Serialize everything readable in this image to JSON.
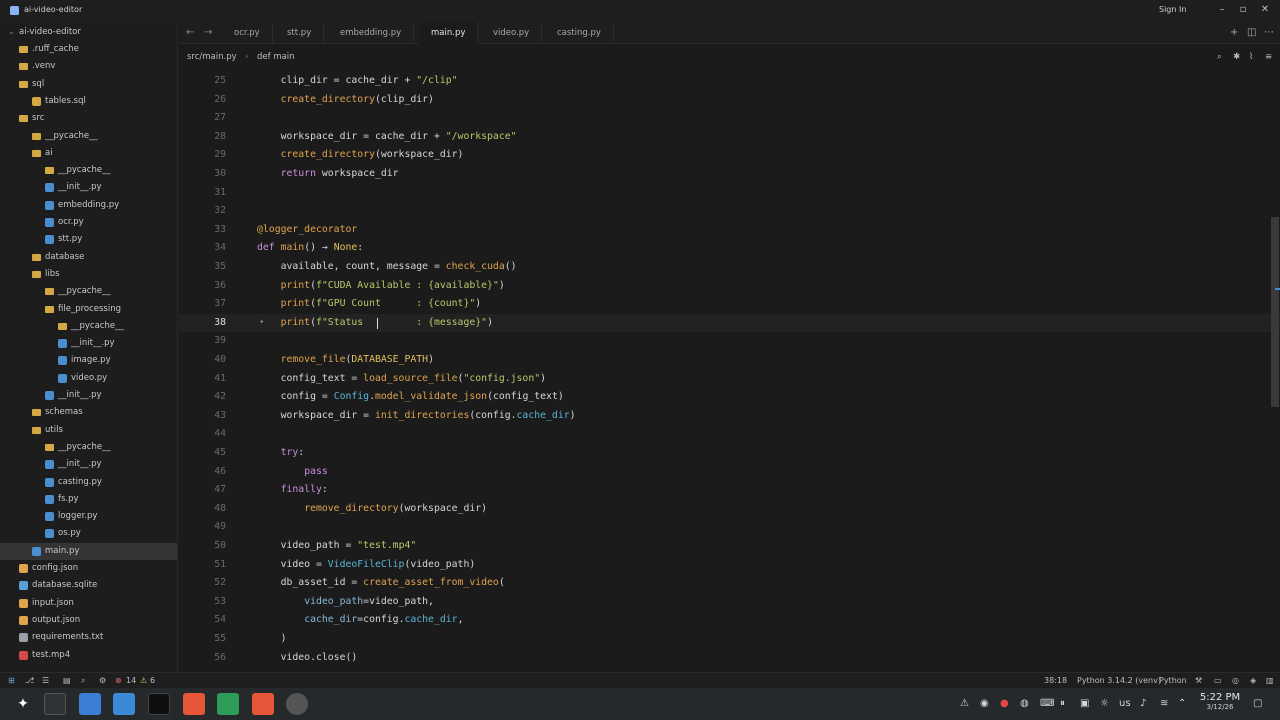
{
  "window": {
    "title": "ai-video-editor",
    "sign_in": "Sign In"
  },
  "sidebar": {
    "root": "ai-video-editor",
    "items": [
      {
        "label": ".ruff_cache",
        "kind": "folder",
        "depth": 1
      },
      {
        "label": ".venv",
        "kind": "folder",
        "depth": 1
      },
      {
        "label": "sql",
        "kind": "folder",
        "depth": 1
      },
      {
        "label": "tables.sql",
        "kind": "sql",
        "depth": 2
      },
      {
        "label": "src",
        "kind": "folder",
        "depth": 1
      },
      {
        "label": "__pycache__",
        "kind": "folder",
        "depth": 2
      },
      {
        "label": "ai",
        "kind": "folder",
        "depth": 2
      },
      {
        "label": "__pycache__",
        "kind": "folder",
        "depth": 3
      },
      {
        "label": "__init__.py",
        "kind": "py",
        "depth": 3
      },
      {
        "label": "embedding.py",
        "kind": "py",
        "depth": 3
      },
      {
        "label": "ocr.py",
        "kind": "py",
        "depth": 3
      },
      {
        "label": "stt.py",
        "kind": "py",
        "depth": 3
      },
      {
        "label": "database",
        "kind": "folder",
        "depth": 2
      },
      {
        "label": "libs",
        "kind": "folder",
        "depth": 2
      },
      {
        "label": "__pycache__",
        "kind": "folder",
        "depth": 3
      },
      {
        "label": "file_processing",
        "kind": "folder",
        "depth": 3
      },
      {
        "label": "__pycache__",
        "kind": "folder",
        "depth": 4
      },
      {
        "label": "__init__.py",
        "kind": "py",
        "depth": 4
      },
      {
        "label": "image.py",
        "kind": "py",
        "depth": 4
      },
      {
        "label": "video.py",
        "kind": "py",
        "depth": 4
      },
      {
        "label": "__init__.py",
        "kind": "py",
        "depth": 3
      },
      {
        "label": "schemas",
        "kind": "folder",
        "depth": 2
      },
      {
        "label": "utils",
        "kind": "folder",
        "depth": 2
      },
      {
        "label": "__pycache__",
        "kind": "folder",
        "depth": 3
      },
      {
        "label": "__init__.py",
        "kind": "py",
        "depth": 3
      },
      {
        "label": "casting.py",
        "kind": "py",
        "depth": 3
      },
      {
        "label": "fs.py",
        "kind": "py",
        "depth": 3
      },
      {
        "label": "logger.py",
        "kind": "py",
        "depth": 3
      },
      {
        "label": "os.py",
        "kind": "py",
        "depth": 3
      },
      {
        "label": "main.py",
        "kind": "py",
        "depth": 2,
        "selected": true
      },
      {
        "label": "config.json",
        "kind": "json",
        "depth": 1
      },
      {
        "label": "database.sqlite",
        "kind": "db",
        "depth": 1
      },
      {
        "label": "input.json",
        "kind": "json",
        "depth": 1
      },
      {
        "label": "output.json",
        "kind": "json",
        "depth": 1
      },
      {
        "label": "requirements.txt",
        "kind": "txt",
        "depth": 1
      },
      {
        "label": "test.mp4",
        "kind": "video",
        "depth": 1
      }
    ]
  },
  "tabs": [
    {
      "label": "ocr.py"
    },
    {
      "label": "stt.py"
    },
    {
      "label": "embedding.py"
    },
    {
      "label": "main.py",
      "active": true
    },
    {
      "label": "video.py"
    },
    {
      "label": "casting.py"
    }
  ],
  "breadcrumb": {
    "path": "src/main.py",
    "symbol": "def main"
  },
  "editor": {
    "current_line": 38,
    "lines": [
      {
        "n": "25",
        "text": "    clip_dir = cache_dir + \"/clip\""
      },
      {
        "n": "26",
        "text": "    create_directory(clip_dir)"
      },
      {
        "n": "27",
        "text": ""
      },
      {
        "n": "28",
        "text": "    workspace_dir = cache_dir + \"/workspace\""
      },
      {
        "n": "29",
        "text": "    create_directory(workspace_dir)"
      },
      {
        "n": "30",
        "text": "    return workspace_dir"
      },
      {
        "n": "31",
        "text": ""
      },
      {
        "n": "32",
        "text": ""
      },
      {
        "n": "33",
        "text": "@logger_decorator"
      },
      {
        "n": "34",
        "text": "def main() → None:"
      },
      {
        "n": "35",
        "text": "    available, count, message = check_cuda()"
      },
      {
        "n": "36",
        "text": "    print(f\"CUDA Available : {available}\")"
      },
      {
        "n": "37",
        "text": "    print(f\"GPU Count      : {count}\")"
      },
      {
        "n": "38",
        "text": "    print(f\"Status         : {message}\")"
      },
      {
        "n": "39",
        "text": ""
      },
      {
        "n": "40",
        "text": "    remove_file(DATABASE_PATH)"
      },
      {
        "n": "41",
        "text": "    config_text = load_source_file(\"config.json\")"
      },
      {
        "n": "42",
        "text": "    config = Config.model_validate_json(config_text)"
      },
      {
        "n": "43",
        "text": "    workspace_dir = init_directories(config.cache_dir)"
      },
      {
        "n": "44",
        "text": ""
      },
      {
        "n": "45",
        "text": "    try:"
      },
      {
        "n": "46",
        "text": "        pass"
      },
      {
        "n": "47",
        "text": "    finally:"
      },
      {
        "n": "48",
        "text": "        remove_directory(workspace_dir)"
      },
      {
        "n": "49",
        "text": ""
      },
      {
        "n": "50",
        "text": "    video_path = \"test.mp4\""
      },
      {
        "n": "51",
        "text": "    video = VideoFileClip(video_path)"
      },
      {
        "n": "52",
        "text": "    db_asset_id = create_asset_from_video("
      },
      {
        "n": "53",
        "text": "        video_path=video_path,"
      },
      {
        "n": "54",
        "text": "        cache_dir=config.cache_dir,"
      },
      {
        "n": "55",
        "text": "    )"
      },
      {
        "n": "56",
        "text": "    video.close()"
      }
    ]
  },
  "statusbar": {
    "errors": "14",
    "warnings": "6",
    "cursor_pos": "38:18",
    "interpreter": "Python 3.14.2 (venv)",
    "language": "Python"
  },
  "taskbar": {
    "keyboard": "us",
    "time": "5:22 PM",
    "date": "3/12/26"
  },
  "colors": {
    "folder": "#d4a843",
    "py": "#4b8ed0",
    "accent_current_line": "#222222"
  }
}
